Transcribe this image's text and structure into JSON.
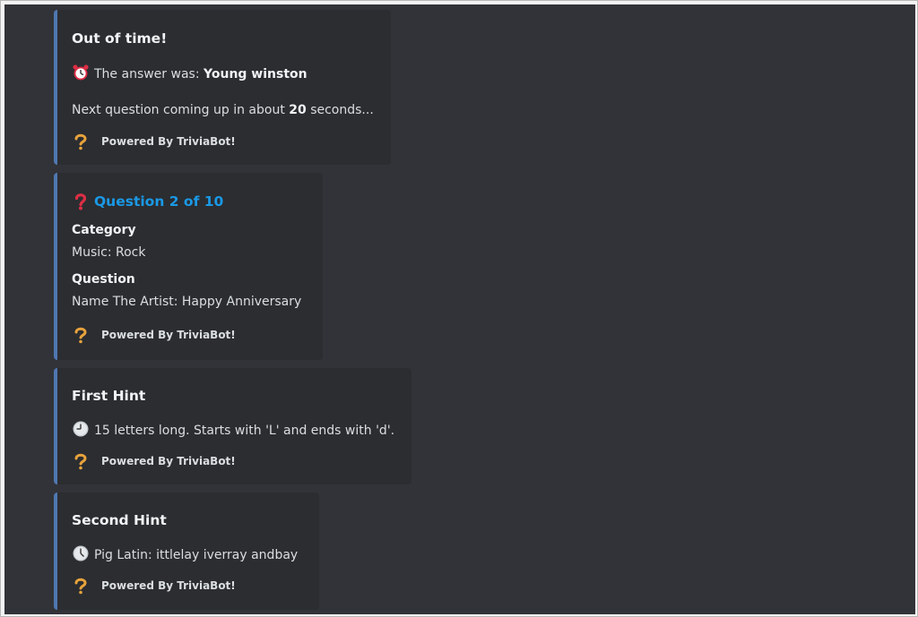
{
  "embeds": {
    "out_of_time": {
      "title": "Out of time!",
      "answer_prefix": "The answer was: ",
      "answer": "Young winston",
      "next_prefix": "Next question coming up in about ",
      "next_seconds": "20",
      "next_suffix": " seconds...",
      "footer": "Powered By TriviaBot!"
    },
    "question": {
      "title": "Question 2 of 10",
      "category_label": "Category",
      "category_value": "Music: Rock",
      "question_label": "Question",
      "question_value": "Name The Artist: Happy Anniversary",
      "footer": "Powered By TriviaBot!"
    },
    "first_hint": {
      "title": "First Hint",
      "text": "15 letters long. Starts with 'L' and ends with 'd'.",
      "footer": "Powered By TriviaBot!"
    },
    "second_hint": {
      "title": "Second Hint",
      "text": "Pig Latin: ittlelay iverray andbay",
      "footer": "Powered By TriviaBot!"
    }
  },
  "icons": {
    "alarm": "alarm-clock-icon",
    "question": "red-question-icon",
    "clock_hint1": "clock-icon",
    "clock_hint2": "clock-icon",
    "footer": "triviabot-icon"
  },
  "colors": {
    "background": "#323338",
    "embed_bg": "#2b2d31",
    "embed_border": "#4f77b1",
    "title_link": "#1a99e6"
  }
}
